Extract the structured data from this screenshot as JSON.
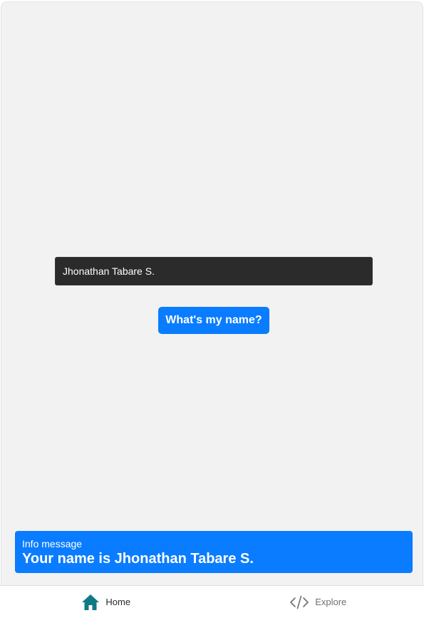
{
  "form": {
    "name_value": "Jhonathan Tabare S.",
    "submit_label": "What's my name?"
  },
  "info": {
    "title": "Info message",
    "message": "Your name is Jhonathan Tabare S."
  },
  "tabbar": {
    "items": [
      {
        "label": "Home",
        "icon": "home-icon",
        "active": true
      },
      {
        "label": "Explore",
        "icon": "code-icon",
        "active": false
      }
    ]
  },
  "colors": {
    "accent": "#0a7cff",
    "input_bg": "#2b2b2b",
    "page_bg": "#f2f2f2"
  }
}
